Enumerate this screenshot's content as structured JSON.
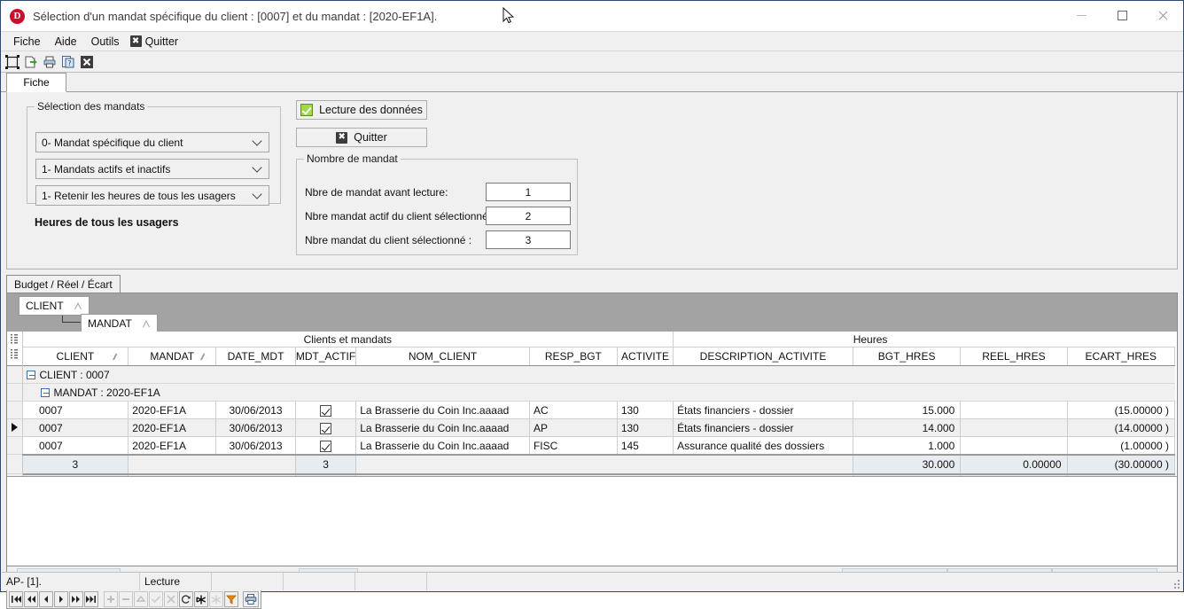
{
  "window": {
    "title": "Sélection d'un mandat spécifique du client : [0007] et du mandat : [2020-EF1A].",
    "logo_letter": "D",
    "minimize": "–",
    "maximize": "□",
    "close": "✕"
  },
  "menu": {
    "items": [
      {
        "label": "Fiche",
        "icon": null
      },
      {
        "label": "Aide",
        "icon": null
      },
      {
        "label": "Outils",
        "icon": null
      },
      {
        "label": "Quitter",
        "icon": "x-badge"
      }
    ]
  },
  "toolbar": {
    "buttons": [
      {
        "name": "select-all-icon",
        "glyph": "▣"
      },
      {
        "name": "export-icon",
        "glyph": "📄"
      },
      {
        "name": "print-icon",
        "glyph": "🖨"
      },
      {
        "name": "help-icon",
        "glyph": "📋"
      },
      {
        "name": "close-icon",
        "glyph": "✖"
      }
    ]
  },
  "tabs": {
    "fiche": "Fiche",
    "budget": "Budget / Réel / Écart"
  },
  "selection_panel": {
    "group_title": "Sélection des mandats",
    "dropdowns": [
      "0- Mandat spécifique du client",
      "1- Mandats actifs et inactifs",
      "1- Retenir les heures de tous les usagers"
    ],
    "note": "Heures de tous les usagers",
    "read_button": "Lecture des données",
    "quit_button": "Quitter"
  },
  "nombre_panel": {
    "group_title": "Nombre de mandat",
    "rows": [
      {
        "label": "Nbre de mandat avant lecture:",
        "value": "1"
      },
      {
        "label": "Nbre mandat actif du client sélectionné :",
        "value": "2"
      },
      {
        "label": "Nbre mandat du client sélectionné :",
        "value": "3"
      }
    ]
  },
  "group_chips": [
    {
      "label": "CLIENT"
    },
    {
      "label": "MANDAT"
    }
  ],
  "grid": {
    "band_groups": [
      {
        "label": "Clients et mandats",
        "span": 7
      },
      {
        "label": "Heures",
        "span": 3
      }
    ],
    "columns": [
      {
        "key": "CLIENT",
        "label": "CLIENT",
        "sortable": true
      },
      {
        "key": "MANDAT",
        "label": "MANDAT",
        "sortable": true
      },
      {
        "key": "DATE_MDT",
        "label": "DATE_MDT",
        "sortable": false
      },
      {
        "key": "MDT_ACTIF",
        "label": "MDT_ACTIF",
        "sortable": false
      },
      {
        "key": "NOM_CLIENT",
        "label": "NOM_CLIENT",
        "sortable": false
      },
      {
        "key": "RESP_BGT",
        "label": "RESP_BGT",
        "sortable": false
      },
      {
        "key": "ACTIVITE",
        "label": "ACTIVITE",
        "sortable": false
      },
      {
        "key": "DESCRIPTION_ACTIVITE",
        "label": "DESCRIPTION_ACTIVITE",
        "sortable": false
      },
      {
        "key": "BGT_HRES",
        "label": "BGT_HRES",
        "sortable": false
      },
      {
        "key": "REEL_HRES",
        "label": "REEL_HRES",
        "sortable": false
      },
      {
        "key": "ECART_HRES",
        "label": "ECART_HRES",
        "sortable": false
      }
    ],
    "group_rows": [
      {
        "label": "CLIENT : 0007",
        "level": 0
      },
      {
        "label": "MANDAT : 2020-EF1A",
        "level": 1
      }
    ],
    "rows": [
      {
        "CLIENT": "0007",
        "MANDAT": "2020-EF1A",
        "DATE_MDT": "30/06/2013",
        "MDT_ACTIF": true,
        "NOM_CLIENT": "La Brasserie du Coin Inc.aaaad",
        "RESP_BGT": "AC",
        "ACTIVITE": "130",
        "DESCRIPTION_ACTIVITE": "États financiers - dossier",
        "BGT_HRES": "15.000",
        "REEL_HRES": "",
        "ECART_HRES": "(15.00000 )"
      },
      {
        "CLIENT": "0007",
        "MANDAT": "2020-EF1A",
        "DATE_MDT": "30/06/2013",
        "MDT_ACTIF": true,
        "NOM_CLIENT": "La Brasserie du Coin Inc.aaaad",
        "RESP_BGT": "AP",
        "ACTIVITE": "130",
        "DESCRIPTION_ACTIVITE": "États financiers - dossier",
        "BGT_HRES": "14.000",
        "REEL_HRES": "",
        "ECART_HRES": "(14.00000 )"
      },
      {
        "CLIENT": "0007",
        "MANDAT": "2020-EF1A",
        "DATE_MDT": "30/06/2013",
        "MDT_ACTIF": true,
        "NOM_CLIENT": "La Brasserie du Coin Inc.aaaad",
        "RESP_BGT": "FISC",
        "ACTIVITE": "145",
        "DESCRIPTION_ACTIVITE": "Assurance qualité des dossiers",
        "BGT_HRES": "1.000",
        "REEL_HRES": "",
        "ECART_HRES": "(1.00000 )"
      }
    ],
    "summary_mandat": {
      "count": "3",
      "actif_count": "3",
      "BGT_HRES": "30.000",
      "REEL_HRES": "0.00000",
      "ECART_HRES": "(30.00000 )"
    },
    "summary_client": {
      "count": "3",
      "actif_count": "3",
      "BGT_HRES": "30.000",
      "REEL_HRES": "0.00000",
      "ECART_HRES": "(30.00000 )"
    },
    "summary_grand": {
      "count": "3",
      "actif_count": "3",
      "BGT_HRES": "30.000",
      "REEL_HRES": "0.00000",
      "ECART_HRES": "(30.00000 )"
    }
  },
  "navigator": {
    "buttons": [
      {
        "name": "first-record-button",
        "glyph": "|◀◀",
        "enabled": true
      },
      {
        "name": "prior-page-button",
        "glyph": "◀◀",
        "enabled": true
      },
      {
        "name": "prior-record-button",
        "glyph": "◀",
        "enabled": true
      },
      {
        "name": "next-record-button",
        "glyph": "▶",
        "enabled": true
      },
      {
        "name": "next-page-button",
        "glyph": "▶▶",
        "enabled": true
      },
      {
        "name": "last-record-button",
        "glyph": "▶▶|",
        "enabled": true
      },
      {
        "name": "insert-record-button",
        "glyph": "+",
        "enabled": false
      },
      {
        "name": "delete-record-button",
        "glyph": "–",
        "enabled": false
      },
      {
        "name": "edit-record-button",
        "glyph": "▲",
        "enabled": false
      },
      {
        "name": "post-edit-button",
        "glyph": "✓",
        "enabled": false
      },
      {
        "name": "cancel-edit-button",
        "glyph": "✗",
        "enabled": false
      },
      {
        "name": "refresh-button",
        "glyph": "↻",
        "enabled": true
      },
      {
        "name": "expand-all-button",
        "glyph": "✳",
        "enabled": true
      },
      {
        "name": "collapse-all-button",
        "glyph": "✳",
        "enabled": false
      },
      {
        "name": "filter-button",
        "glyph": "▼",
        "enabled": true
      },
      {
        "name": "print-grid-button",
        "glyph": "🖨",
        "enabled": true
      }
    ]
  },
  "statusbar": {
    "cells": [
      "AP- [1].",
      "Lecture",
      "",
      "",
      "",
      ""
    ]
  },
  "colors": {
    "accent_border": "#2b4a72",
    "logo_red": "#c8102e",
    "band_grey": "#a3a3a3",
    "panel_grey": "#f0f0f0",
    "summary_blue": "#e6ecf0",
    "check_green": "#9fd84a",
    "filter_orange": "#e8860c"
  }
}
